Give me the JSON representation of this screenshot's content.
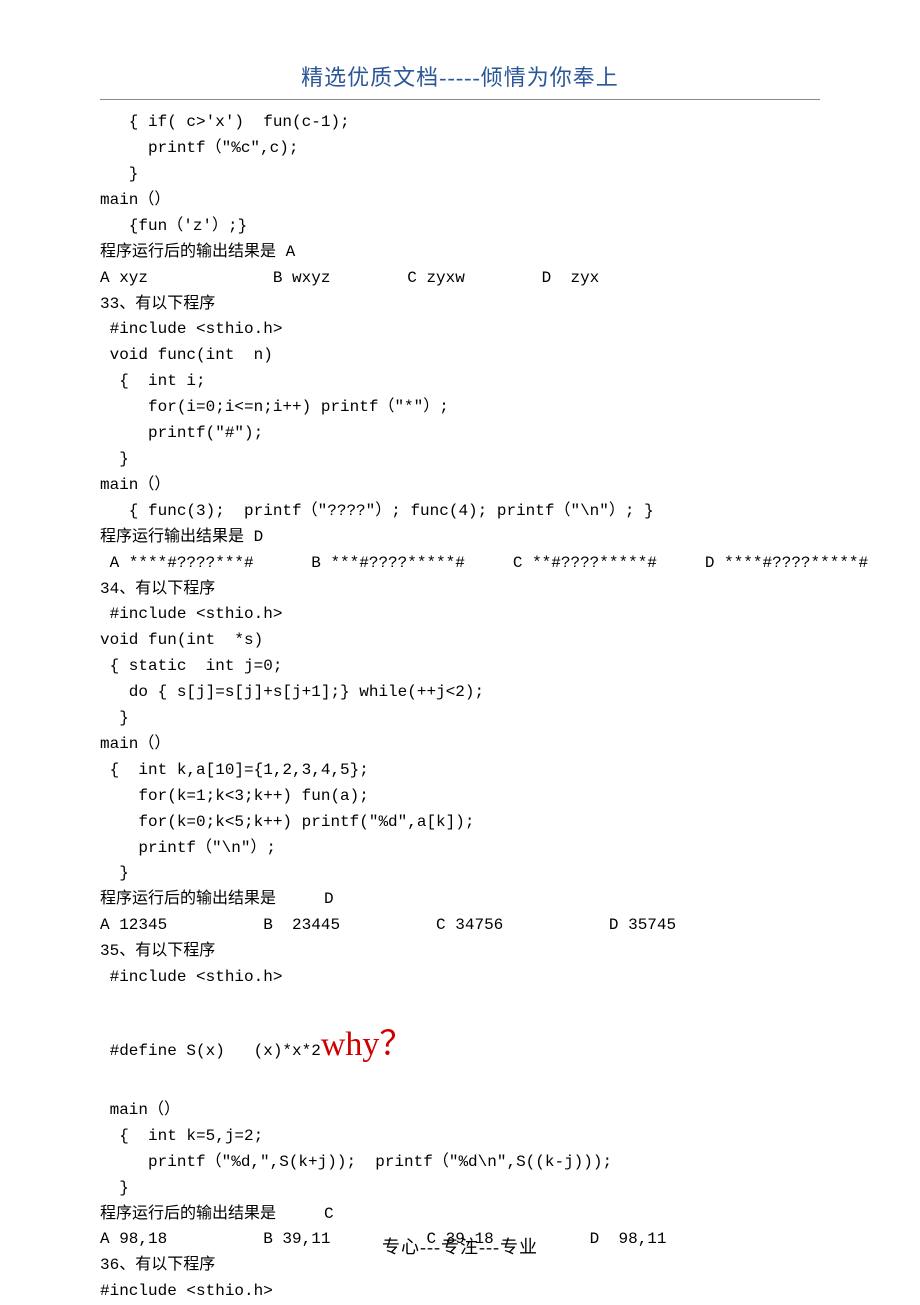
{
  "header": "精选优质文档-----倾情为你奉上",
  "footer": "专心---专注---专业",
  "why": "why？",
  "lines": {
    "l00": "   { if( c>'x')  fun(c-1);",
    "l01": "     printf（\"%c\",c);",
    "l02": "   }",
    "l03": "main（）",
    "l04": "   {fun（'z'）;}",
    "l05": "程序运行后的输出结果是 A",
    "l06": "A xyz             B wxyz        C zyxw        D  zyx",
    "l07": "33、有以下程序",
    "l08": " #include <sthio.h>",
    "l09": " void func(int  n)",
    "l10": "  {  int i;",
    "l11": "     for(i=0;i<=n;i++) printf（\"*\"）;",
    "l12": "     printf(\"#\");",
    "l13": "  }",
    "l14": "main（）",
    "l15": "   { func(3);  printf（\"????\"）; func(4); printf（\"\\n\"）; }",
    "l16": "程序运行输出结果是 D",
    "l17": " A ****#????***#      B ***#????*****#     C **#????*****#     D ****#????*****#",
    "l18": "34、有以下程序",
    "l19": " #include <sthio.h>",
    "l20": "void fun(int  *s)",
    "l21": " { static  int j=0;",
    "l22": "   do { s[j]=s[j]+s[j+1];} while(++j<2);",
    "l23": "  }",
    "l24": "main（）",
    "l25": " {  int k,a[10]={1,2,3,4,5};",
    "l26": "    for(k=1;k<3;k++) fun(a);",
    "l27": "    for(k=0;k<5;k++) printf(\"%d\",a[k]);",
    "l28": "    printf（\"\\n\"）;",
    "l29": "  }",
    "l30": "程序运行后的输出结果是     D",
    "l31": "A 12345          B  23445          C 34756           D 35745",
    "l32": "35、有以下程序",
    "l33": " #include <sthio.h>",
    "l34_pre": " #define S(x)   (x)*x*2",
    "l35": " main（）",
    "l36": "  {  int k=5,j=2;",
    "l37": "     printf（\"%d,\",S(k+j));  printf（\"%d\\n\",S((k-j)));",
    "l38": "  }",
    "l39": "程序运行后的输出结果是     C",
    "l40": "A 98,18          B 39,11          C 39,18          D  98,11",
    "l41": "36、有以下程序",
    "l42": "#include <sthio.h>"
  }
}
